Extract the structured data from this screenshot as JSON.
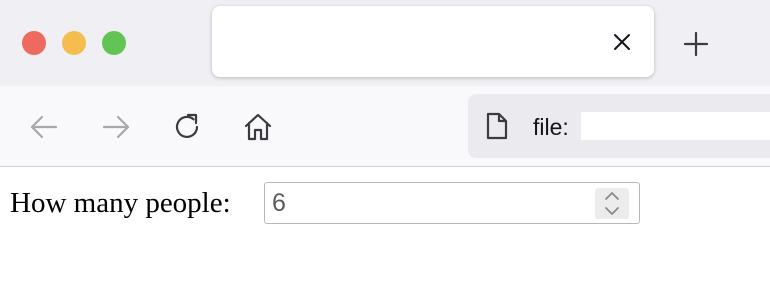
{
  "browser": {
    "window_controls": {
      "close_color": "#ee6a5f",
      "minimize_color": "#f5bd4f",
      "zoom_color": "#61c454"
    },
    "tab": {
      "title": "",
      "close_icon": "close-icon"
    },
    "new_tab_icon": "plus-icon",
    "toolbar": {
      "back_icon": "arrow-left-icon",
      "forward_icon": "arrow-right-icon",
      "reload_icon": "reload-icon",
      "home_icon": "home-icon"
    },
    "url_bar": {
      "page_icon": "page-icon",
      "url": "file:"
    }
  },
  "page": {
    "label": "How many people:",
    "number_input": {
      "value": "6",
      "spinner_up_icon": "chevron-up-icon",
      "spinner_down_icon": "chevron-down-icon"
    }
  }
}
